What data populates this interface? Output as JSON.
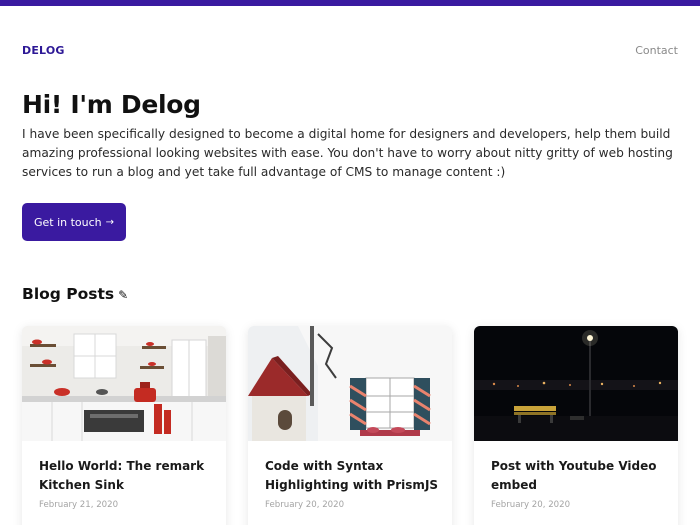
{
  "header": {
    "logo": "DELOG",
    "nav_contact": "Contact"
  },
  "hero": {
    "title": "Hi! I'm Delog",
    "description": "I have been specifically designed to become a digital home for designers and developers, help them build amazing professional looking websites with ease. You don't have to worry about nitty gritty of web hosting services to run a blog and yet take full advantage of CMS to manage content :)",
    "cta_label": "Get in touch",
    "cta_icon": "arrow-right-icon"
  },
  "blog": {
    "section_title": "Blog Posts",
    "section_icon": "pencil-icon",
    "posts": [
      {
        "title": "Hello World: The remark Kitchen Sink",
        "date": "February 21, 2020",
        "image": "kitchen-photo"
      },
      {
        "title": "Code with Syntax Highlighting with PrismJS",
        "date": "February 20, 2020",
        "image": "building-photo"
      },
      {
        "title": "Post with Youtube Video embed",
        "date": "February 20, 2020",
        "image": "night-bench-photo"
      }
    ]
  },
  "colors": {
    "brand": "#3a1aa0",
    "text": "#111111",
    "muted": "#8a8a8a"
  }
}
